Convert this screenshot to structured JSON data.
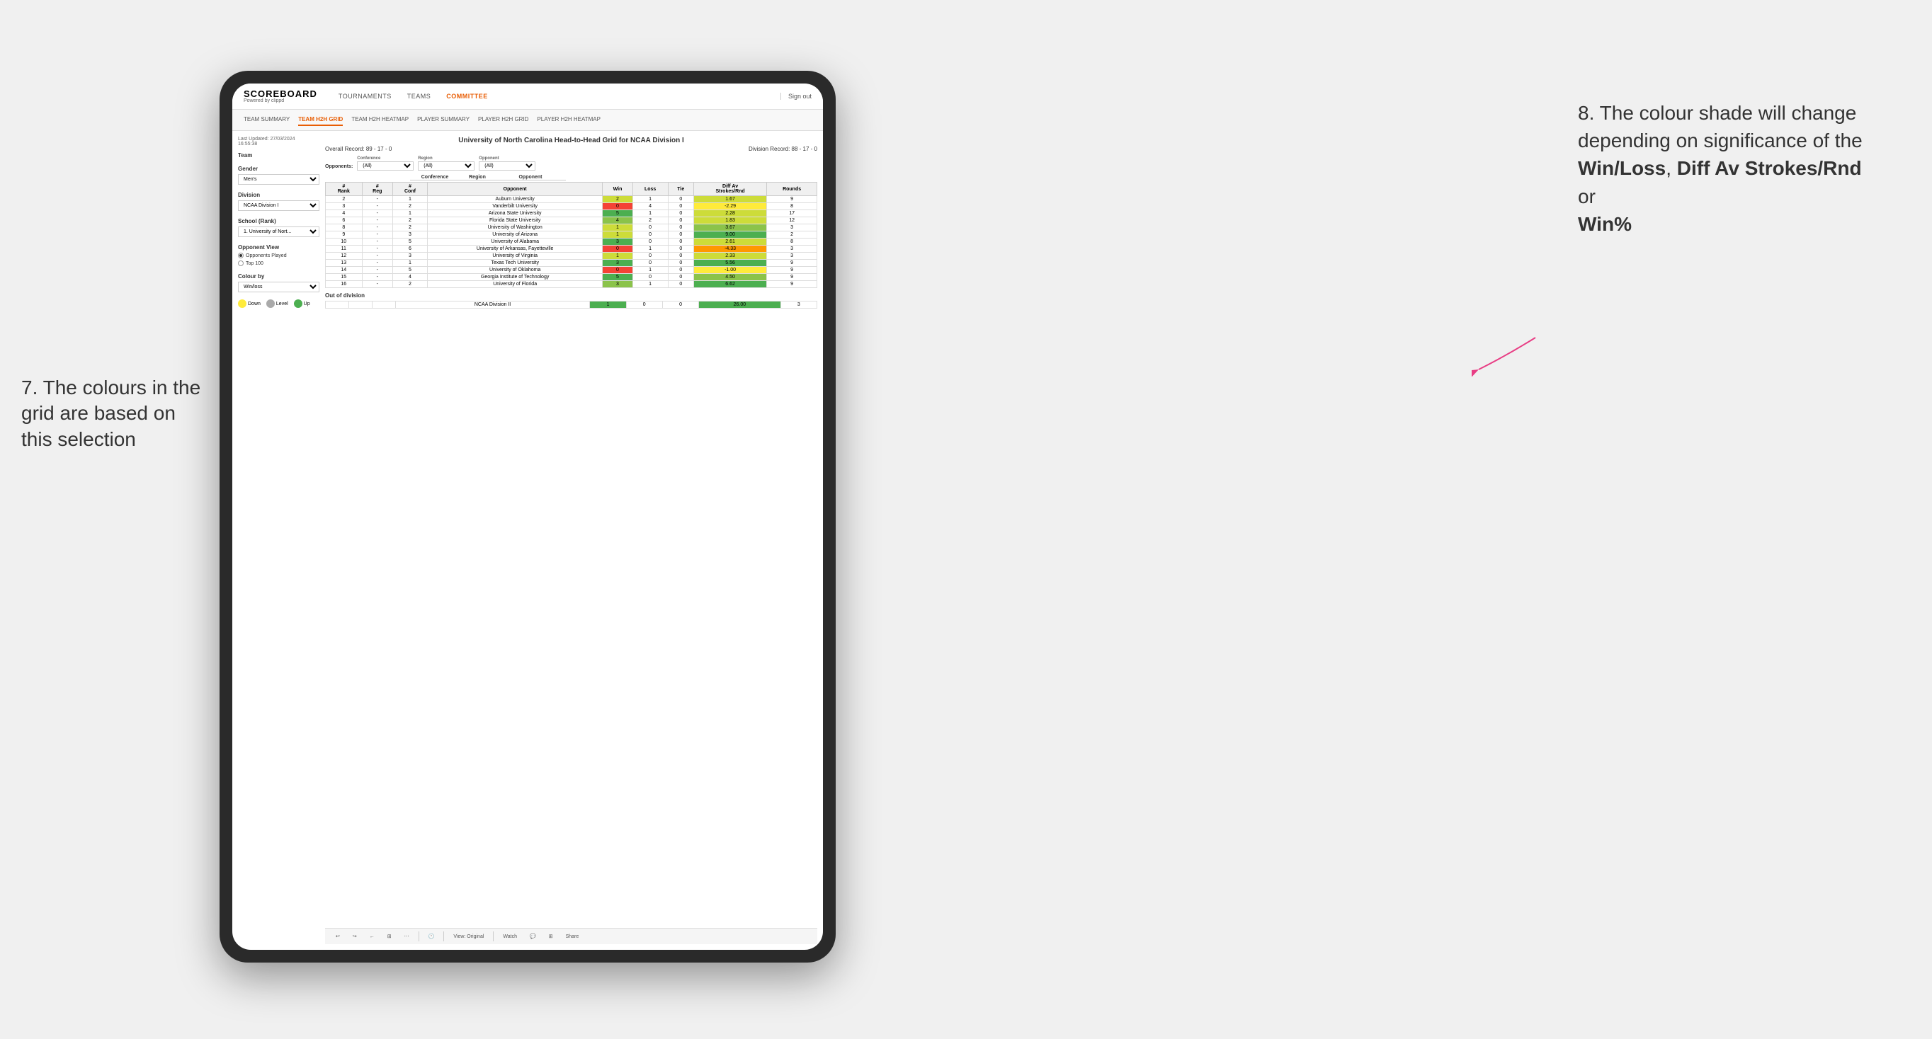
{
  "app": {
    "logo": "SCOREBOARD",
    "logo_sub": "Powered by clippd",
    "nav": [
      "TOURNAMENTS",
      "TEAMS",
      "COMMITTEE"
    ],
    "active_nav": "COMMITTEE",
    "sign_out": "Sign out",
    "sub_nav": [
      "TEAM SUMMARY",
      "TEAM H2H GRID",
      "TEAM H2H HEATMAP",
      "PLAYER SUMMARY",
      "PLAYER H2H GRID",
      "PLAYER H2H HEATMAP"
    ],
    "active_sub": "TEAM H2H GRID"
  },
  "sidebar": {
    "last_updated_label": "Last Updated: 27/03/2024",
    "last_updated_time": "16:55:38",
    "team_label": "Team",
    "gender_label": "Gender",
    "gender_value": "Men's",
    "division_label": "Division",
    "division_value": "NCAA Division I",
    "school_label": "School (Rank)",
    "school_value": "1. University of Nort...",
    "opponent_view_label": "Opponent View",
    "opponent_view_options": [
      "Opponents Played",
      "Top 100"
    ],
    "opponent_view_selected": "Opponents Played",
    "colour_by_label": "Colour by",
    "colour_by_value": "Win/loss",
    "legend_down": "Down",
    "legend_level": "Level",
    "legend_up": "Up"
  },
  "grid": {
    "title": "University of North Carolina Head-to-Head Grid for NCAA Division I",
    "overall_record_label": "Overall Record:",
    "overall_record": "89 - 17 - 0",
    "division_record_label": "Division Record:",
    "division_record": "88 - 17 - 0",
    "filter_labels": {
      "conference": "Conference",
      "region": "Region",
      "opponent": "Opponent",
      "opponents": "Opponents:"
    },
    "filter_values": {
      "conference": "(All)",
      "region": "(All)",
      "opponent": "(All)"
    },
    "col_headers": [
      "Conference",
      "Region",
      "Opponent"
    ],
    "table_headers": [
      "#\nRank",
      "#\nReg",
      "#\nConf",
      "Opponent",
      "Win",
      "Loss",
      "Tie",
      "Diff Av\nStrokes/Rnd",
      "Rounds"
    ],
    "rows": [
      {
        "rank": "2",
        "reg": "-",
        "conf": "1",
        "opponent": "Auburn University",
        "win": "2",
        "loss": "1",
        "tie": "0",
        "diff": "1.67",
        "rounds": "9",
        "win_color": "green-light",
        "diff_color": "green-light"
      },
      {
        "rank": "3",
        "reg": "-",
        "conf": "2",
        "opponent": "Vanderbilt University",
        "win": "0",
        "loss": "4",
        "tie": "0",
        "diff": "-2.29",
        "rounds": "8",
        "win_color": "red",
        "diff_color": "yellow"
      },
      {
        "rank": "4",
        "reg": "-",
        "conf": "1",
        "opponent": "Arizona State University",
        "win": "5",
        "loss": "1",
        "tie": "0",
        "diff": "2.28",
        "rounds": "17",
        "win_color": "green-dark",
        "diff_color": "green-light"
      },
      {
        "rank": "6",
        "reg": "-",
        "conf": "2",
        "opponent": "Florida State University",
        "win": "4",
        "loss": "2",
        "tie": "0",
        "diff": "1.83",
        "rounds": "12",
        "win_color": "green-mid",
        "diff_color": "green-light"
      },
      {
        "rank": "8",
        "reg": "-",
        "conf": "2",
        "opponent": "University of Washington",
        "win": "1",
        "loss": "0",
        "tie": "0",
        "diff": "3.67",
        "rounds": "3",
        "win_color": "green-light",
        "diff_color": "green-mid"
      },
      {
        "rank": "9",
        "reg": "-",
        "conf": "3",
        "opponent": "University of Arizona",
        "win": "1",
        "loss": "0",
        "tie": "0",
        "diff": "9.00",
        "rounds": "2",
        "win_color": "green-light",
        "diff_color": "green-dark"
      },
      {
        "rank": "10",
        "reg": "-",
        "conf": "5",
        "opponent": "University of Alabama",
        "win": "3",
        "loss": "0",
        "tie": "0",
        "diff": "2.61",
        "rounds": "8",
        "win_color": "green-dark",
        "diff_color": "green-light"
      },
      {
        "rank": "11",
        "reg": "-",
        "conf": "6",
        "opponent": "University of Arkansas, Fayetteville",
        "win": "0",
        "loss": "1",
        "tie": "0",
        "diff": "-4.33",
        "rounds": "3",
        "win_color": "red",
        "diff_color": "orange"
      },
      {
        "rank": "12",
        "reg": "-",
        "conf": "3",
        "opponent": "University of Virginia",
        "win": "1",
        "loss": "0",
        "tie": "0",
        "diff": "2.33",
        "rounds": "3",
        "win_color": "green-light",
        "diff_color": "green-light"
      },
      {
        "rank": "13",
        "reg": "-",
        "conf": "1",
        "opponent": "Texas Tech University",
        "win": "3",
        "loss": "0",
        "tie": "0",
        "diff": "5.56",
        "rounds": "9",
        "win_color": "green-dark",
        "diff_color": "green-dark"
      },
      {
        "rank": "14",
        "reg": "-",
        "conf": "5",
        "opponent": "University of Oklahoma",
        "win": "0",
        "loss": "1",
        "tie": "0",
        "diff": "-1.00",
        "rounds": "9",
        "win_color": "red",
        "diff_color": "yellow"
      },
      {
        "rank": "15",
        "reg": "-",
        "conf": "4",
        "opponent": "Georgia Institute of Technology",
        "win": "5",
        "loss": "0",
        "tie": "0",
        "diff": "4.50",
        "rounds": "9",
        "win_color": "green-dark",
        "diff_color": "green-mid"
      },
      {
        "rank": "16",
        "reg": "-",
        "conf": "2",
        "opponent": "University of Florida",
        "win": "3",
        "loss": "1",
        "tie": "0",
        "diff": "6.62",
        "rounds": "9",
        "win_color": "green-mid",
        "diff_color": "green-dark"
      }
    ],
    "out_of_division_label": "Out of division",
    "out_of_division_row": {
      "opponent": "NCAA Division II",
      "win": "1",
      "loss": "0",
      "tie": "0",
      "diff": "26.00",
      "rounds": "3",
      "win_color": "green-dark",
      "diff_color": "green-dark"
    }
  },
  "toolbar": {
    "view_label": "View: Original",
    "watch_label": "Watch",
    "share_label": "Share"
  },
  "annotations": {
    "left_text": "7. The colours in the grid are based on this selection",
    "right_number": "8.",
    "right_text": "The colour shade will change depending on significance of the",
    "right_bold1": "Win/Loss",
    "right_comma": ", ",
    "right_bold2": "Diff Av Strokes/Rnd",
    "right_or": " or",
    "right_bold3": "Win%"
  },
  "colors": {
    "accent": "#e85d04",
    "arrow": "#e83d84",
    "green_dark": "#4caf50",
    "green_mid": "#8bc34a",
    "green_light": "#cddc39",
    "yellow": "#ffeb3b",
    "orange": "#ff9800",
    "red": "#f44336",
    "legend_yellow": "#ffeb3b",
    "legend_gray": "#aaaaaa",
    "legend_green": "#4caf50"
  }
}
